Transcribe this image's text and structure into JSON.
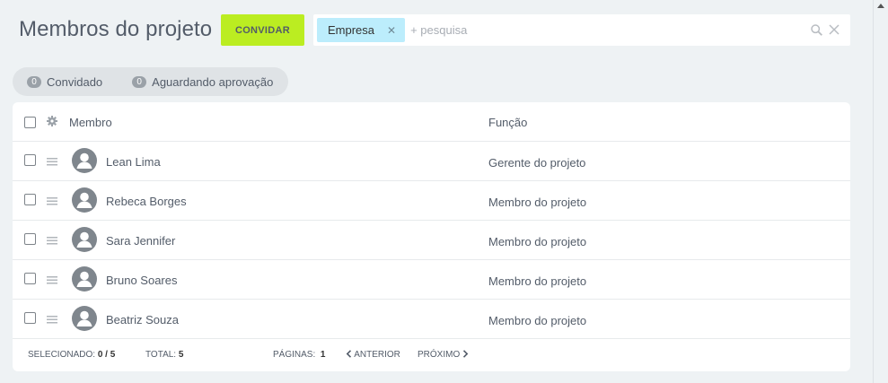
{
  "header": {
    "title": "Membros do projeto",
    "invite_label": "CONVIDAR"
  },
  "search": {
    "chip_label": "Empresa",
    "placeholder": "+ pesquisa"
  },
  "filters": [
    {
      "count": "0",
      "label": "Convidado"
    },
    {
      "count": "0",
      "label": "Aguardando aprovação"
    }
  ],
  "table": {
    "columns": {
      "member": "Membro",
      "role": "Função"
    },
    "rows": [
      {
        "name": "Lean Lima",
        "role": "Gerente do projeto"
      },
      {
        "name": "Rebeca Borges",
        "role": "Membro do projeto"
      },
      {
        "name": "Sara Jennifer",
        "role": "Membro do projeto"
      },
      {
        "name": "Bruno Soares",
        "role": "Membro do projeto"
      },
      {
        "name": "Beatriz Souza",
        "role": "Membro do projeto"
      }
    ]
  },
  "footer": {
    "selected_label": "SELECIONADO:",
    "selected_value": "0 / 5",
    "total_label": "TOTAL:",
    "total_value": "5",
    "pages_label": "PÁGINAS:",
    "pages_value": "1",
    "prev_label": "ANTERIOR",
    "next_label": "PRÓXIMO"
  },
  "colors": {
    "accent": "#bbed21",
    "chip": "#bcedfc",
    "background": "#eef2f4"
  }
}
